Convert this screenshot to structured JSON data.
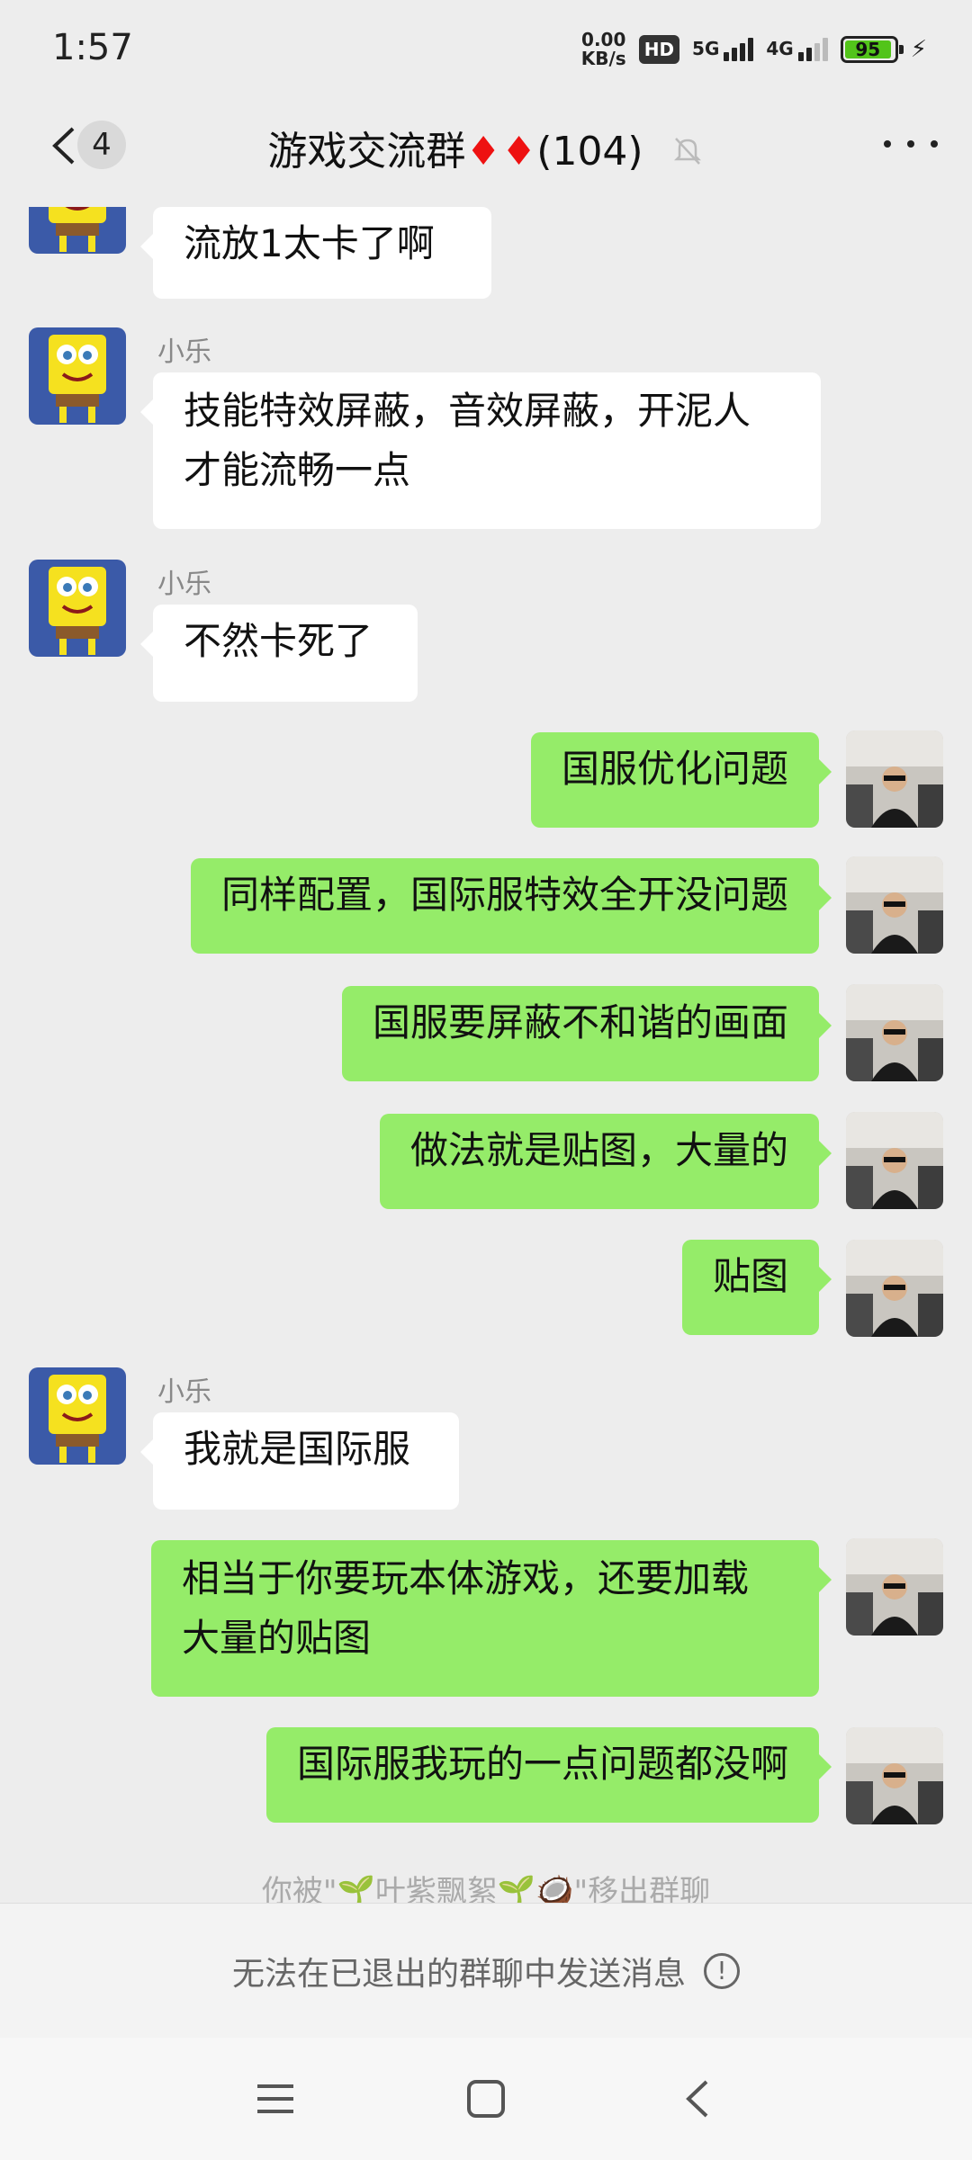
{
  "status": {
    "time": "1:57",
    "netspeed_top": "0.00",
    "netspeed_bottom": "KB/s",
    "hd": "HD",
    "net1": "5G",
    "net2": "4G",
    "battery": "95"
  },
  "header": {
    "unread_count": "4",
    "title": "游戏交流群",
    "member_count": "(104)"
  },
  "messages": {
    "m1": "流放1太卡了啊",
    "sender2": "小乐",
    "m2a": "技能特效屏蔽，音效屏蔽，开泥人",
    "m2b": "才能流畅一点",
    "sender3": "小乐",
    "m3": "不然卡死了",
    "m4": "国服优化问题",
    "m5": "同样配置，国际服特效全开没问题",
    "m6": "国服要屏蔽不和谐的画面",
    "m7": "做法就是贴图，大量的",
    "m8": "贴图",
    "sender9": "小乐",
    "m9": "我就是国际服",
    "m10a": "相当于你要玩本体游戏，还要加载",
    "m10b": "大量的贴图",
    "m11": "国际服我玩的一点问题都没啊"
  },
  "system_notice": "你被\"🌱叶紫飘絮🌱🥥\"移出群聊",
  "footer": {
    "notice": "无法在已退出的群聊中发送消息",
    "warn_icon": "!"
  },
  "colors": {
    "bg": "#ededed",
    "out_bubble": "#95ec69",
    "in_bubble": "#ffffff"
  }
}
